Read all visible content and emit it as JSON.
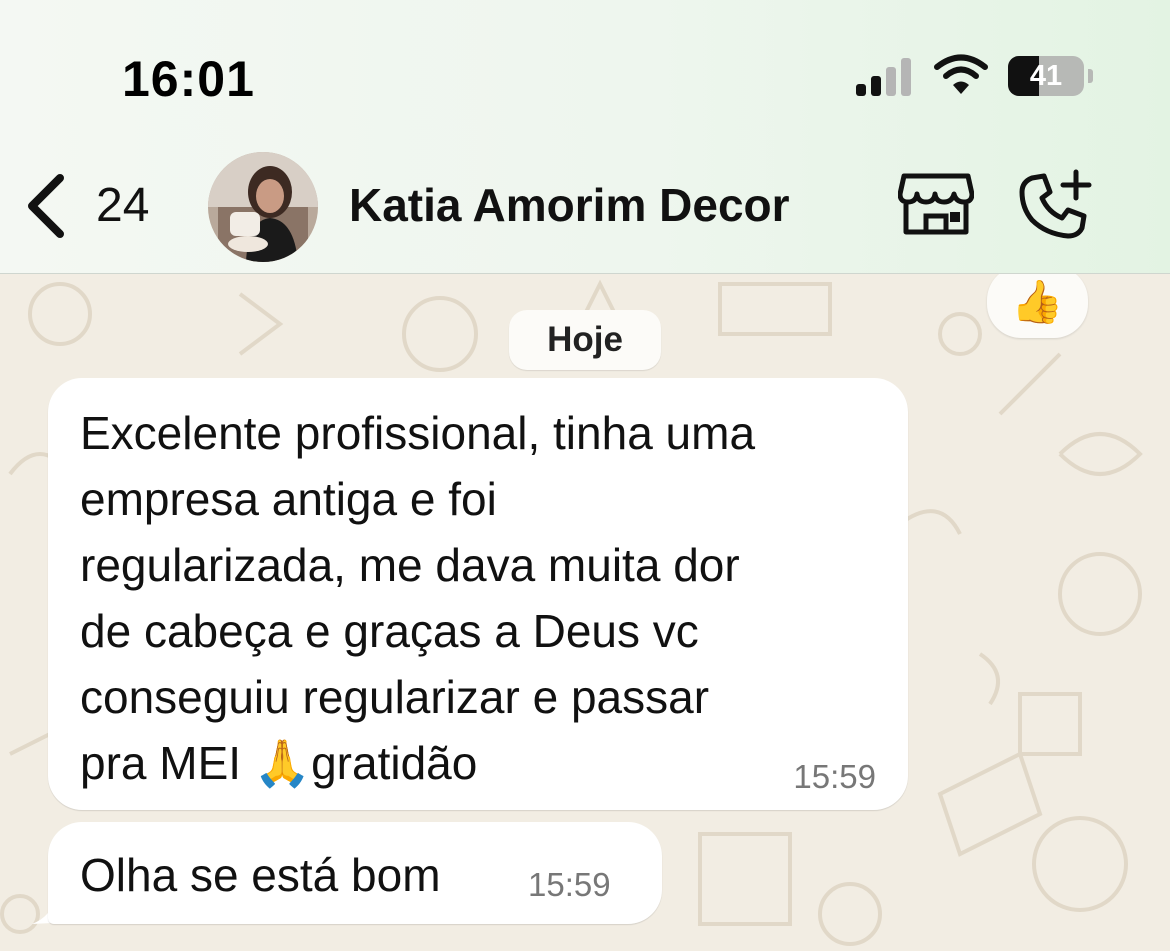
{
  "status_bar": {
    "time": "16:01",
    "battery_level": "41",
    "icons": [
      "cellular-signal-icon",
      "wifi-icon",
      "battery-icon"
    ]
  },
  "nav": {
    "back_count": "24",
    "contact_name": "Katia Amorim Decor",
    "icons": [
      "chevron-left-icon",
      "business-store-icon",
      "add-call-icon"
    ]
  },
  "chat": {
    "date_separator": "Hoje",
    "reaction": "👍",
    "messages": [
      {
        "text": "Excelente profissional,  tinha uma\nempresa antiga e foi\nregularizada, me dava muita dor\nde cabeça e graças a Deus vc\nconseguiu regularizar e passar\npra MEI 🙏gratidão",
        "time": "15:59"
      },
      {
        "text": "Olha se está bom",
        "time": "15:59"
      }
    ]
  },
  "colors": {
    "header_bg": "#eef6ee",
    "chat_bg": "#f2ede3",
    "bubble_bg": "#ffffff",
    "text": "#111111",
    "timestamp": "#777777"
  }
}
